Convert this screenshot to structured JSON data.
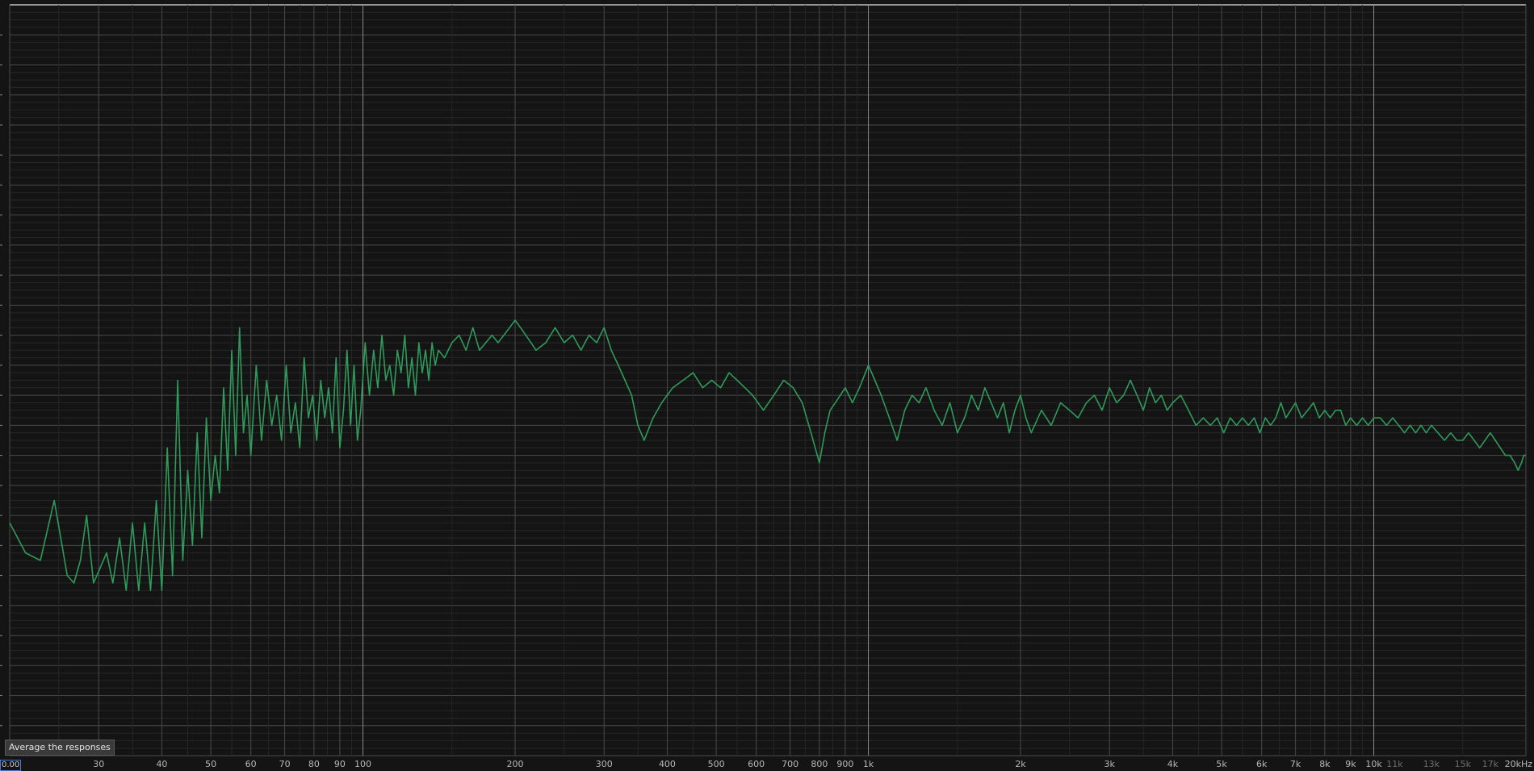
{
  "tooltip": {
    "text": "Average the responses"
  },
  "origin_readout": "0.00",
  "colors": {
    "background": "#141414",
    "grid_major": "#4a4a4a",
    "grid_minor": "#262626",
    "grid_decade": "#8a8a8a",
    "trace": "#2f9a5a"
  },
  "chart_data": {
    "type": "line",
    "title": "",
    "xlabel": "",
    "ylabel": "",
    "x_scale": "log",
    "xlim": [
      20,
      20000
    ],
    "ylim": [
      -100,
      0
    ],
    "grid": true,
    "x_ticks": [
      {
        "value": 30,
        "label": "30"
      },
      {
        "value": 40,
        "label": "40"
      },
      {
        "value": 50,
        "label": "50"
      },
      {
        "value": 60,
        "label": "60"
      },
      {
        "value": 70,
        "label": "70"
      },
      {
        "value": 80,
        "label": "80"
      },
      {
        "value": 90,
        "label": "90"
      },
      {
        "value": 100,
        "label": "100"
      },
      {
        "value": 200,
        "label": "200"
      },
      {
        "value": 300,
        "label": "300"
      },
      {
        "value": 400,
        "label": "400"
      },
      {
        "value": 500,
        "label": "500"
      },
      {
        "value": 600,
        "label": "600"
      },
      {
        "value": 700,
        "label": "700"
      },
      {
        "value": 800,
        "label": "800"
      },
      {
        "value": 900,
        "label": "900"
      },
      {
        "value": 1000,
        "label": "1k"
      },
      {
        "value": 2000,
        "label": "2k"
      },
      {
        "value": 3000,
        "label": "3k"
      },
      {
        "value": 4000,
        "label": "4k"
      },
      {
        "value": 5000,
        "label": "5k"
      },
      {
        "value": 6000,
        "label": "6k"
      },
      {
        "value": 7000,
        "label": "7k"
      },
      {
        "value": 8000,
        "label": "8k"
      },
      {
        "value": 9000,
        "label": "9k"
      },
      {
        "value": 10000,
        "label": "10k"
      },
      {
        "value": 11000,
        "label": "11k",
        "minor": true
      },
      {
        "value": 13000,
        "label": "13k",
        "minor": true
      },
      {
        "value": 15000,
        "label": "15k",
        "minor": true
      },
      {
        "value": 17000,
        "label": "17k",
        "minor": true
      },
      {
        "value": 20000,
        "label": "20kHz"
      }
    ],
    "series": [
      {
        "x": [
          20,
          21.5,
          23,
          24.5,
          26,
          26.8,
          27.6,
          28.4,
          29.3,
          30.2,
          31.1,
          32,
          33,
          34,
          35,
          36,
          37,
          38,
          39,
          40,
          41,
          42,
          43,
          44,
          45,
          46,
          47,
          48,
          49,
          50,
          51,
          52,
          53,
          54,
          55,
          56,
          57,
          58,
          59,
          60,
          61.5,
          63,
          64.5,
          66,
          67.5,
          69,
          70.5,
          72,
          73.5,
          75,
          76.5,
          78,
          79.5,
          81,
          82.5,
          84,
          85.5,
          87,
          88.5,
          90,
          91.5,
          93,
          94.5,
          96,
          97.5,
          99,
          101,
          103,
          105,
          107,
          109,
          111,
          113,
          115,
          117,
          119,
          121,
          123,
          125,
          127,
          129,
          131,
          133,
          135,
          137,
          139,
          141,
          145,
          150,
          155,
          160,
          165,
          170,
          175,
          180,
          185,
          190,
          195,
          200,
          205,
          210,
          215,
          220,
          230,
          240,
          250,
          260,
          270,
          280,
          290,
          300,
          310,
          320,
          330,
          340,
          350,
          360,
          375,
          390,
          410,
          430,
          450,
          470,
          490,
          510,
          530,
          550,
          570,
          590,
          620,
          650,
          680,
          710,
          740,
          770,
          800,
          820,
          840,
          860,
          880,
          900,
          930,
          960,
          1000,
          1030,
          1060,
          1100,
          1140,
          1180,
          1220,
          1260,
          1300,
          1350,
          1400,
          1450,
          1500,
          1550,
          1600,
          1650,
          1700,
          1750,
          1800,
          1850,
          1900,
          1950,
          2000,
          2050,
          2100,
          2200,
          2300,
          2400,
          2500,
          2600,
          2700,
          2800,
          2900,
          3000,
          3100,
          3200,
          3300,
          3400,
          3500,
          3600,
          3700,
          3800,
          3900,
          4000,
          4150,
          4300,
          4450,
          4600,
          4750,
          4900,
          5050,
          5200,
          5350,
          5500,
          5650,
          5800,
          5950,
          6100,
          6250,
          6400,
          6550,
          6700,
          6850,
          7000,
          7200,
          7400,
          7600,
          7800,
          8000,
          8200,
          8400,
          8600,
          8800,
          9000,
          9250,
          9500,
          9750,
          10000,
          10300,
          10600,
          10900,
          11200,
          11500,
          11800,
          12100,
          12400,
          12700,
          13000,
          13400,
          13800,
          14200,
          14600,
          15000,
          15400,
          15800,
          16200,
          16600,
          17000,
          17400,
          17800,
          18200,
          18600,
          19000,
          19300,
          19600,
          19800,
          20000
        ],
        "y": [
          -69,
          -73,
          -74,
          -66,
          -76,
          -77,
          -74,
          -68,
          -77,
          -75,
          -73,
          -77,
          -71,
          -78,
          -69,
          -78,
          -69,
          -78,
          -66,
          -78,
          -59,
          -76,
          -50,
          -74,
          -62,
          -72,
          -57,
          -71,
          -55,
          -66,
          -60,
          -65,
          -51,
          -62,
          -46,
          -60,
          -43,
          -57,
          -52,
          -60,
          -48,
          -58,
          -50,
          -56,
          -52,
          -58,
          -48,
          -57,
          -53,
          -59,
          -47,
          -55,
          -52,
          -58,
          -50,
          -55,
          -51,
          -57,
          -47,
          -59,
          -54,
          -46,
          -56,
          -48,
          -58,
          -54,
          -45,
          -52,
          -46,
          -51,
          -44,
          -50,
          -48,
          -52,
          -46,
          -49,
          -44,
          -51,
          -47,
          -52,
          -45,
          -49,
          -46,
          -50,
          -45,
          -48,
          -46,
          -47,
          -45,
          -44,
          -46,
          -43,
          -46,
          -45,
          -44,
          -45,
          -44,
          -43,
          -42,
          -43,
          -44,
          -45,
          -46,
          -45,
          -43,
          -45,
          -44,
          -46,
          -44,
          -45,
          -43,
          -46,
          -48,
          -50,
          -52,
          -56,
          -58,
          -55,
          -53,
          -51,
          -50,
          -49,
          -51,
          -50,
          -51,
          -49,
          -50,
          -51,
          -52,
          -54,
          -52,
          -50,
          -51,
          -53,
          -57,
          -61,
          -57,
          -54,
          -53,
          -52,
          -51,
          -53,
          -51,
          -48,
          -50,
          -52,
          -55,
          -58,
          -54,
          -52,
          -53,
          -51,
          -54,
          -56,
          -53,
          -57,
          -55,
          -52,
          -54,
          -51,
          -53,
          -55,
          -53,
          -57,
          -54,
          -52,
          -55,
          -57,
          -54,
          -56,
          -53,
          -54,
          -55,
          -53,
          -52,
          -54,
          -51,
          -53,
          -52,
          -50,
          -52,
          -54,
          -51,
          -53,
          -52,
          -54,
          -53,
          -52,
          -54,
          -56,
          -55,
          -56,
          -55,
          -57,
          -55,
          -56,
          -55,
          -56,
          -55,
          -57,
          -55,
          -56,
          -55,
          -53,
          -55,
          -54,
          -53,
          -55,
          -54,
          -53,
          -55,
          -54,
          -55,
          -54,
          -54,
          -56,
          -55,
          -56,
          -55,
          -56,
          -55,
          -55,
          -56,
          -55,
          -56,
          -57,
          -56,
          -57,
          -56,
          -57,
          -56,
          -57,
          -58,
          -57,
          -58,
          -58,
          -57,
          -58,
          -59,
          -58,
          -57,
          -58,
          -59,
          -60,
          -60,
          -61,
          -62,
          -61,
          -60,
          -60
        ]
      }
    ]
  }
}
